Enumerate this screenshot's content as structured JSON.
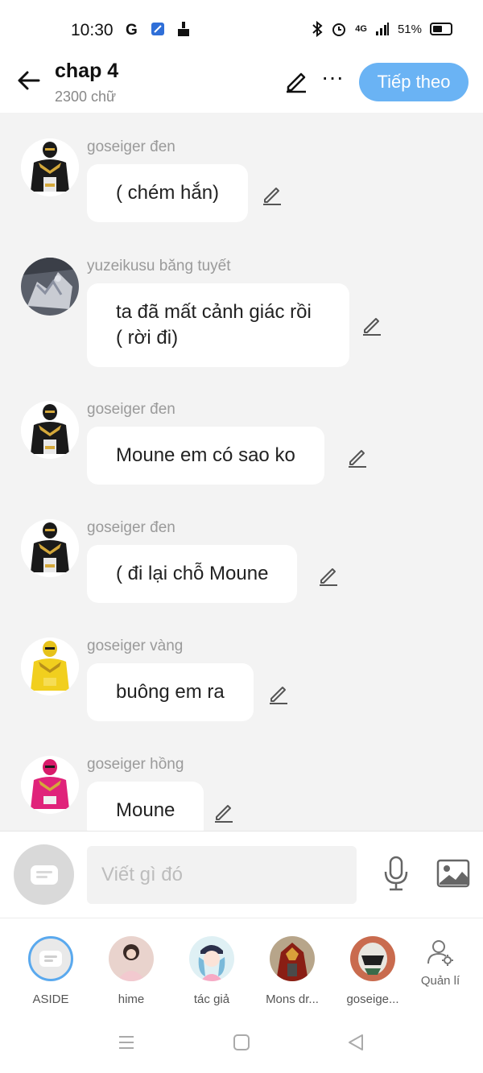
{
  "status_bar": {
    "time": "10:30",
    "battery": "51%",
    "network": "4G",
    "icons": [
      "g-icon",
      "shield-icon",
      "broom-icon",
      "bluetooth-icon",
      "alarm-icon",
      "signal-icon",
      "battery-icon"
    ]
  },
  "header": {
    "title": "chap 4",
    "word_count": "2300 chữ",
    "next_label": "Tiếp theo",
    "accent_color": "#6ab3f4"
  },
  "messages": [
    {
      "sender": "goseiger đen",
      "text": "( chém hắn)",
      "avatar": "black-ranger"
    },
    {
      "sender": "yuzeikusu băng tuyết",
      "text": "ta đã mất cảnh giác rồi ( rời đi)",
      "avatar": "ice-monster"
    },
    {
      "sender": "goseiger đen",
      "text": "Moune em có sao ko",
      "avatar": "black-ranger"
    },
    {
      "sender": "goseiger đen",
      "text": "( đi lại chỗ Moune",
      "avatar": "black-ranger"
    },
    {
      "sender": "goseiger vàng",
      "text": "buông em ra",
      "avatar": "yellow-ranger"
    },
    {
      "sender": "goseiger hồng",
      "text": "Moune",
      "avatar": "pink-ranger"
    }
  ],
  "composer": {
    "placeholder": "Viết gì đó"
  },
  "characters": [
    {
      "name": "ASIDE",
      "selected": true
    },
    {
      "name": "hime"
    },
    {
      "name": "tác giả"
    },
    {
      "name": "Mons dr..."
    },
    {
      "name": "goseige..."
    }
  ],
  "manage_label": "Quản lí"
}
